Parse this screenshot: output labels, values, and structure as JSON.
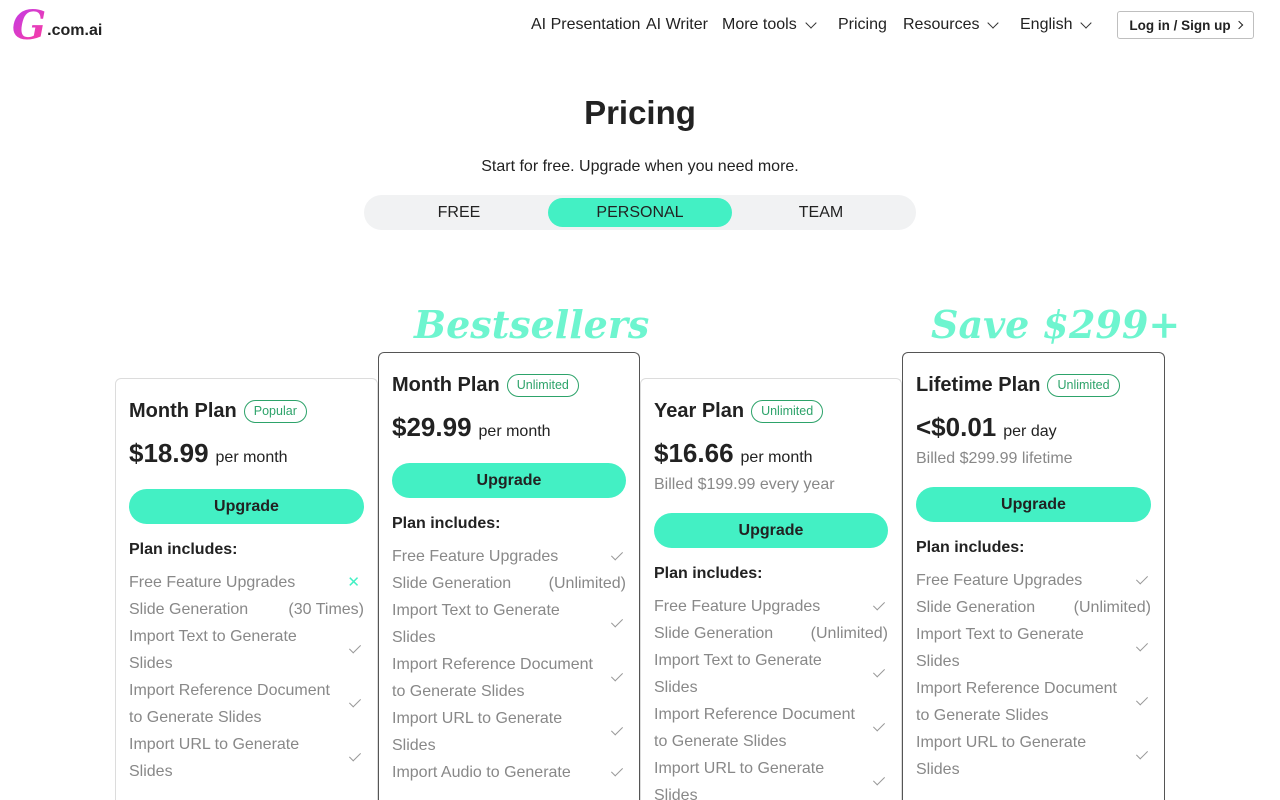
{
  "header": {
    "logo_letter": "G",
    "logo_domain": ".com.ai",
    "nav": [
      "AI Presentation",
      "AI Writer",
      "More tools",
      "Pricing",
      "Resources",
      "English"
    ],
    "login": "Log in / Sign up"
  },
  "hero": {
    "title": "Pricing",
    "subtitle": "Start for free. Upgrade when you need more."
  },
  "tabs": [
    "FREE",
    "PERSONAL",
    "TEAM"
  ],
  "active_tab": "PERSONAL",
  "banners": [
    "Bestsellers",
    "Save $299+"
  ],
  "colors": {
    "accent": "#43f0c4",
    "banner": "#6ef5cf",
    "badge": "#2da36a",
    "logo": "#d63be0"
  },
  "plans": [
    {
      "name": "Month Plan",
      "badge": "Popular",
      "price": "$18.99",
      "period": "per month",
      "billed": "",
      "cta": "Upgrade",
      "includes": "Plan includes:",
      "features": [
        {
          "label": "Free Feature Upgrades",
          "value": "",
          "icon": "cross-icon"
        },
        {
          "label": "Slide Generation",
          "value": "(30 Times)",
          "icon": ""
        },
        {
          "label": "Import Text to Generate Slides",
          "value": "",
          "icon": "check-icon"
        },
        {
          "label": "Import Reference Document to Generate Slides",
          "value": "",
          "icon": "check-icon"
        },
        {
          "label": "Import URL to Generate Slides",
          "value": "",
          "icon": "check-icon"
        }
      ]
    },
    {
      "name": "Month Plan",
      "badge": "Unlimited",
      "price": "$29.99",
      "period": "per month",
      "billed": "",
      "cta": "Upgrade",
      "includes": "Plan includes:",
      "features": [
        {
          "label": "Free Feature Upgrades",
          "value": "",
          "icon": "check-icon"
        },
        {
          "label": "Slide Generation",
          "value": "(Unlimited)",
          "icon": ""
        },
        {
          "label": "Import Text to Generate Slides",
          "value": "",
          "icon": "check-icon"
        },
        {
          "label": "Import Reference Document to Generate Slides",
          "value": "",
          "icon": "check-icon"
        },
        {
          "label": "Import URL to Generate Slides",
          "value": "",
          "icon": "check-icon"
        },
        {
          "label": "Import Audio to Generate",
          "value": "",
          "icon": "check-icon"
        }
      ]
    },
    {
      "name": "Year Plan",
      "badge": "Unlimited",
      "price": "$16.66",
      "period": "per month",
      "billed": "Billed $199.99 every year",
      "cta": "Upgrade",
      "includes": "Plan includes:",
      "features": [
        {
          "label": "Free Feature Upgrades",
          "value": "",
          "icon": "check-icon"
        },
        {
          "label": "Slide Generation",
          "value": "(Unlimited)",
          "icon": ""
        },
        {
          "label": "Import Text to Generate Slides",
          "value": "",
          "icon": "check-icon"
        },
        {
          "label": "Import Reference Document to Generate Slides",
          "value": "",
          "icon": "check-icon"
        },
        {
          "label": "Import URL to Generate Slides",
          "value": "",
          "icon": "check-icon"
        }
      ]
    },
    {
      "name": "Lifetime Plan",
      "badge": "Unlimited",
      "price": "<$0.01",
      "period": "per day",
      "billed": "Billed $299.99 lifetime",
      "cta": "Upgrade",
      "includes": "Plan includes:",
      "features": [
        {
          "label": "Free Feature Upgrades",
          "value": "",
          "icon": "check-icon"
        },
        {
          "label": "Slide Generation",
          "value": "(Unlimited)",
          "icon": ""
        },
        {
          "label": "Import Text to Generate Slides",
          "value": "",
          "icon": "check-icon"
        },
        {
          "label": "Import Reference Document to Generate Slides",
          "value": "",
          "icon": "check-icon"
        },
        {
          "label": "Import URL to Generate Slides",
          "value": "",
          "icon": "check-icon"
        }
      ]
    }
  ]
}
